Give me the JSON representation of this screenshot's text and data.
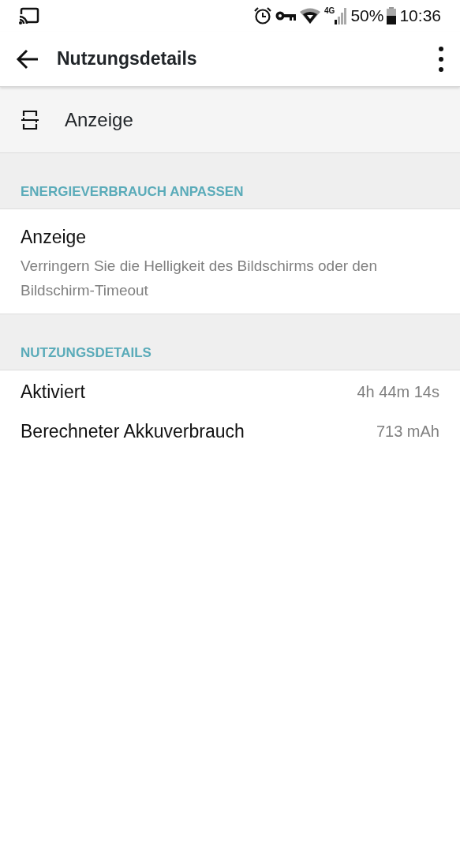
{
  "status_bar": {
    "network": "4G",
    "battery": "50%",
    "time": "10:36"
  },
  "toolbar": {
    "title": "Nutzungsdetails"
  },
  "app": {
    "name": "Anzeige"
  },
  "sections": [
    {
      "header": "ENERGIEVERBRAUCH ANPASSEN",
      "items": [
        {
          "kind": "pref",
          "title": "Anzeige",
          "summary": "Verringern Sie die Helligkeit des Bildschirms oder den Bildschirm-Timeout"
        }
      ]
    },
    {
      "header": "NUTZUNGSDETAILS",
      "items": [
        {
          "kind": "stat",
          "title": "Aktiviert",
          "value": "4h 44m 14s"
        },
        {
          "kind": "stat",
          "title": "Berechneter Akkuverbrauch",
          "value": "713 mAh"
        }
      ]
    }
  ]
}
